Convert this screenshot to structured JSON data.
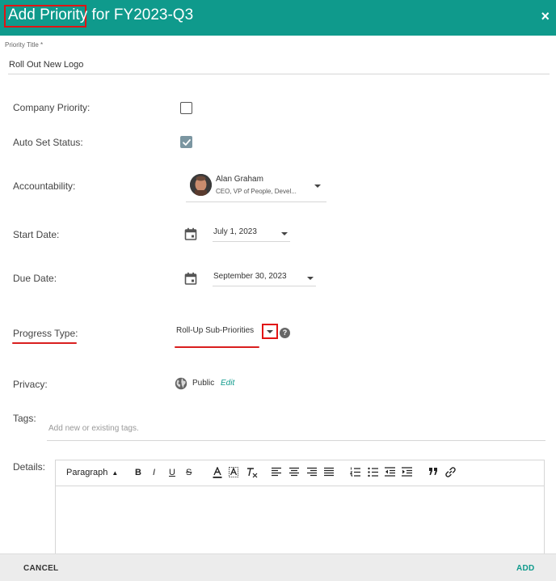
{
  "header": {
    "title_highlight": "Add Priority",
    "title_rest": " for FY2023-Q3",
    "close_glyph": "×"
  },
  "priority_title": {
    "label": "Priority Title *",
    "value": "Roll Out New Logo"
  },
  "company_priority": {
    "label": "Company Priority:",
    "checked": false
  },
  "auto_set_status": {
    "label": "Auto Set Status:",
    "checked": true
  },
  "accountability": {
    "label": "Accountability:",
    "name": "Alan Graham",
    "role": "CEO, VP of People, Devel..."
  },
  "start_date": {
    "label": "Start Date:",
    "value": "July 1, 2023"
  },
  "due_date": {
    "label": "Due Date:",
    "value": "September 30, 2023"
  },
  "progress_type": {
    "label": "Progress Type:",
    "value": "Roll-Up Sub-Priorities",
    "help": "?"
  },
  "privacy": {
    "label": "Privacy:",
    "value": "Public",
    "edit_label": "Edit"
  },
  "tags": {
    "label": "Tags:",
    "placeholder": "Add new or existing tags."
  },
  "details": {
    "label": "Details:",
    "paragraph_label": "Paragraph",
    "bold": "B",
    "italic": "I",
    "underline": "U",
    "strike": "S"
  },
  "footer": {
    "cancel_label": "CANCEL",
    "add_label": "ADD"
  },
  "colors": {
    "header_bg": "#0f9a8c",
    "accent": "#0f9a8c",
    "annotation_red": "#e11414",
    "checkbox_checked": "#7b96a1"
  }
}
